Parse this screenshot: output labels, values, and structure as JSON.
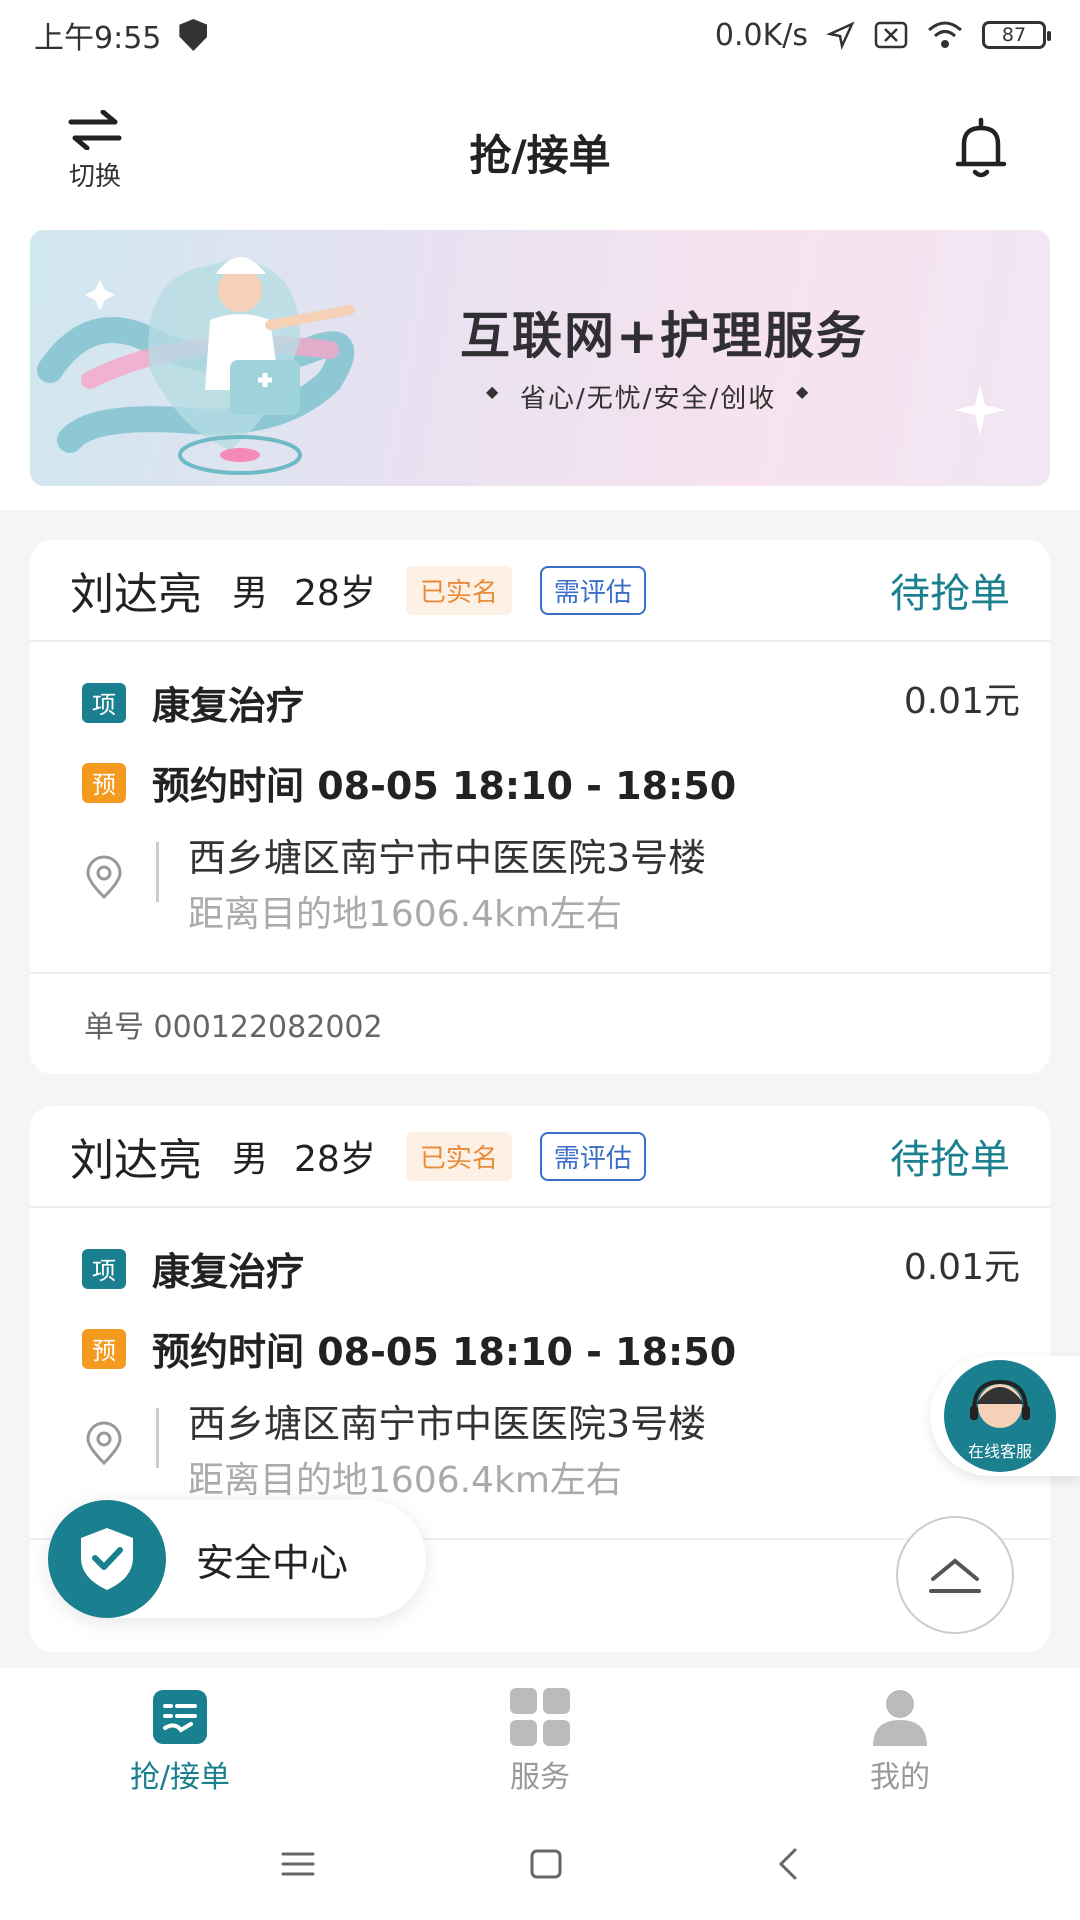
{
  "status_bar": {
    "time": "上午9:55",
    "net_speed": "0.0K/s",
    "battery": "87"
  },
  "header": {
    "switch_label": "切换",
    "title": "抢/接单"
  },
  "banner": {
    "title": "互联网+护理服务",
    "subtitle": "省心/无忧/安全/创收"
  },
  "orders": [
    {
      "name": "刘达亮",
      "gender": "男",
      "age": "28岁",
      "tag_verified": "已实名",
      "tag_assess": "需评估",
      "status": "待抢单",
      "item_badge": "项",
      "item": "康复治疗",
      "price": "0.01元",
      "appt_badge": "预",
      "appt": "预约时间  08-05  18:10 - 18:50",
      "address": "西乡塘区南宁市中医医院3号楼",
      "distance": "距离目的地1606.4km左右",
      "order_no": "单号 000122082002"
    },
    {
      "name": "刘达亮",
      "gender": "男",
      "age": "28岁",
      "tag_verified": "已实名",
      "tag_assess": "需评估",
      "status": "待抢单",
      "item_badge": "项",
      "item": "康复治疗",
      "price": "0.01元",
      "appt_badge": "预",
      "appt": "预约时间  08-05  18:10 - 18:50",
      "address": "西乡塘区南宁市中医医院3号楼",
      "distance": "距离目的地1606.4km左右"
    }
  ],
  "floating": {
    "service_label": "在线客服",
    "safety_label": "安全中心"
  },
  "bottom_nav": [
    {
      "label": "抢/接单",
      "icon": "order-icon",
      "active": true
    },
    {
      "label": "服务",
      "icon": "grid-icon",
      "active": false
    },
    {
      "label": "我的",
      "icon": "person-icon",
      "active": false
    }
  ],
  "colors": {
    "accent": "#1a7f8e",
    "orange": "#f39a1f",
    "blue_tag": "#3b6fc7"
  }
}
